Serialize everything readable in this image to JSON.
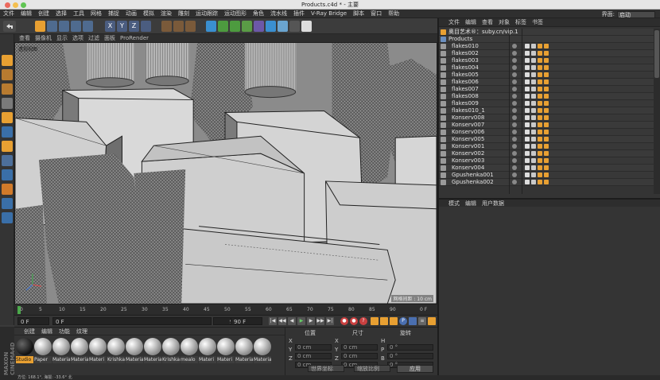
{
  "window": {
    "title": "Products.c4d * - 主要"
  },
  "menubar": {
    "items": [
      "文件",
      "编辑",
      "创建",
      "选择",
      "工具",
      "网格",
      "捕捉",
      "动画",
      "模拟",
      "渲染",
      "雕刻",
      "运动跟踪",
      "运动图形",
      "角色",
      "流水线",
      "插件",
      "V-Ray Bridge",
      "脚本",
      "窗口",
      "帮助"
    ],
    "layout_label": "界面:",
    "layout_value": "启动"
  },
  "viewport": {
    "menu": [
      "查看",
      "摄像机",
      "显示",
      "选项",
      "过滤",
      "面板",
      "ProRender"
    ],
    "camera_label": "透视视图",
    "grid_info": "网格间距 : 10 cm"
  },
  "timeline": {
    "ticks": [
      "0",
      "5",
      "10",
      "15",
      "20",
      "25",
      "30",
      "35",
      "40",
      "45",
      "50",
      "55",
      "60",
      "65",
      "70",
      "75",
      "80",
      "85",
      "90"
    ],
    "end_label": "0 F"
  },
  "transport": {
    "current_frame": "0 F",
    "start_frame": "0 F",
    "end_frame": "90 F",
    "end_frame2": "90 F"
  },
  "materials": {
    "menu": [
      "创建",
      "编辑",
      "功能",
      "纹理"
    ],
    "items": [
      "Studio",
      "Paper",
      "Materia",
      "Materia",
      "Materi",
      "Krishka",
      "Materia",
      "Materia",
      "Krishka",
      "mealo",
      "Materi",
      "Materi",
      "Materia",
      "Materia",
      "Chips"
    ]
  },
  "brand": "MAXON CINEMA4D",
  "coords": {
    "header": [
      "位置",
      "尺寸",
      "旋转"
    ],
    "rows": [
      {
        "axis": "X",
        "pos": "0 cm",
        "size": "0 cm",
        "rot_axis": "H",
        "rot": "0 °"
      },
      {
        "axis": "Y",
        "pos": "0 cm",
        "size": "0 cm",
        "rot_axis": "P",
        "rot": "0 °"
      },
      {
        "axis": "Z",
        "pos": "0 cm",
        "size": "0 cm",
        "rot_axis": "B",
        "rot": "0 °"
      }
    ],
    "mode_dropdown": "世界坐标",
    "scale_dropdown": "缩放比例",
    "apply_label": "应用"
  },
  "status": {
    "text": "方位: 168.1°, 海拔: -33.6°  北"
  },
  "objects": {
    "menu": [
      "文件",
      "编辑",
      "查看",
      "对象",
      "标签",
      "书签"
    ],
    "header_item": "奥目艺术®：suby.cn/vip.1",
    "items": [
      "Products",
      "flakes010",
      "flakes002",
      "flakes003",
      "flakes004",
      "flakes005",
      "flakes006",
      "flakes007",
      "flakes008",
      "flakes009",
      "flakes010_1",
      "Konserv008",
      "Konserv007",
      "Konserv006",
      "Konserv005",
      "Konserv001",
      "Konserv002",
      "Konserv003",
      "Konserv004",
      "Gpushenka001",
      "Gpushenka002"
    ]
  },
  "attributes": {
    "menu": [
      "模式",
      "编辑",
      "用户数据"
    ]
  },
  "colors": {
    "accent_orange": "#e8a032",
    "selection_blue": "#3d6fb3",
    "panel_bg": "#343434"
  }
}
